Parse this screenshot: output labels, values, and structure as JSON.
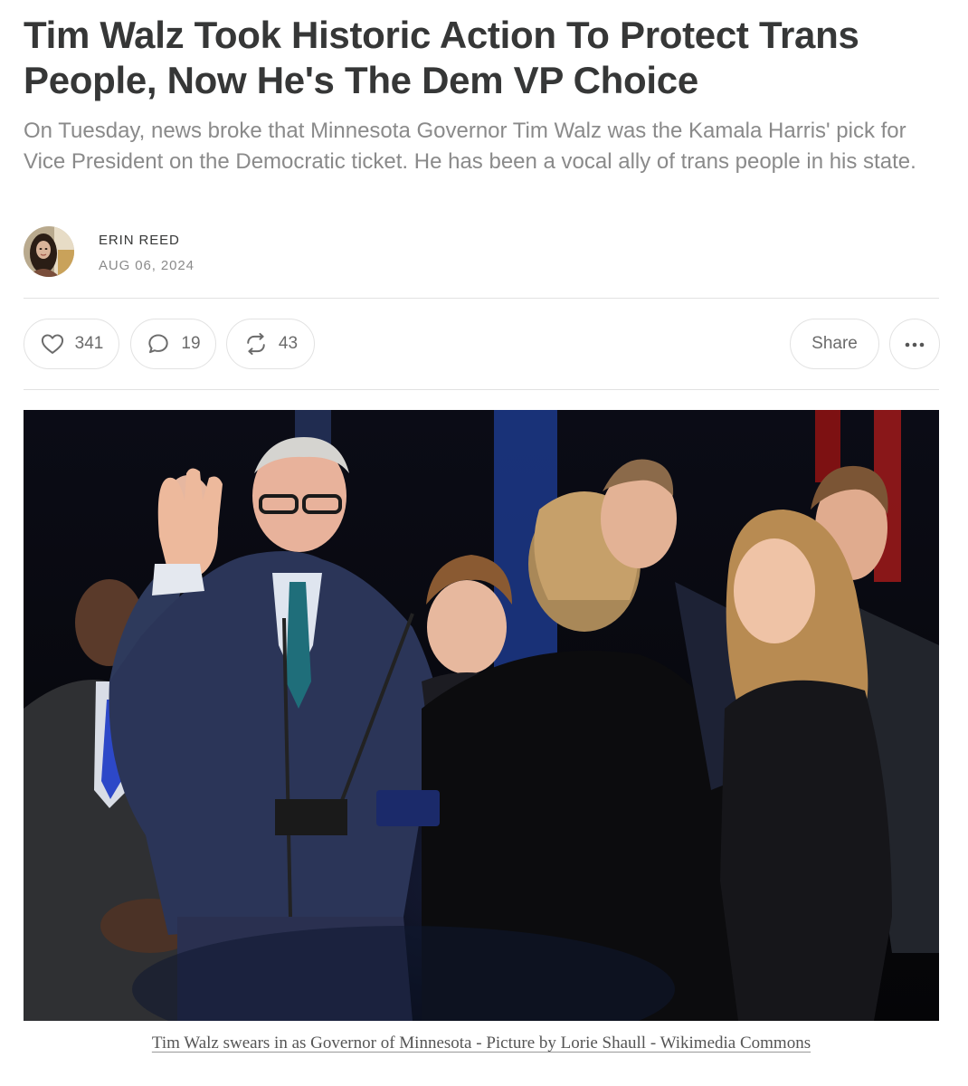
{
  "article": {
    "title": "Tim Walz Took Historic Action To Protect Trans People, Now He's The Dem VP Choice",
    "subtitle": "On Tuesday, news broke that Minnesota Governor Tim Walz was the Kamala Harris' pick for Vice President on the Democratic ticket. He has been a vocal ally of trans people in his state.",
    "author": "ERIN REED",
    "date": "AUG 06, 2024",
    "caption": "Tim Walz swears in as Governor of Minnesota - Picture by Lorie Shaull - Wikimedia Commons"
  },
  "actions": {
    "likes": "341",
    "comments": "19",
    "restacks": "43",
    "share_label": "Share",
    "more_label": "•••"
  },
  "icons": {
    "like": "heart-icon",
    "comment": "comment-bubble-icon",
    "restack": "restack-arrows-icon",
    "more": "more-dots-icon"
  },
  "colors": {
    "title": "#363737",
    "subtitle": "#8a8a8a",
    "border": "#e2e2e2",
    "icon": "#6b6b6b"
  }
}
